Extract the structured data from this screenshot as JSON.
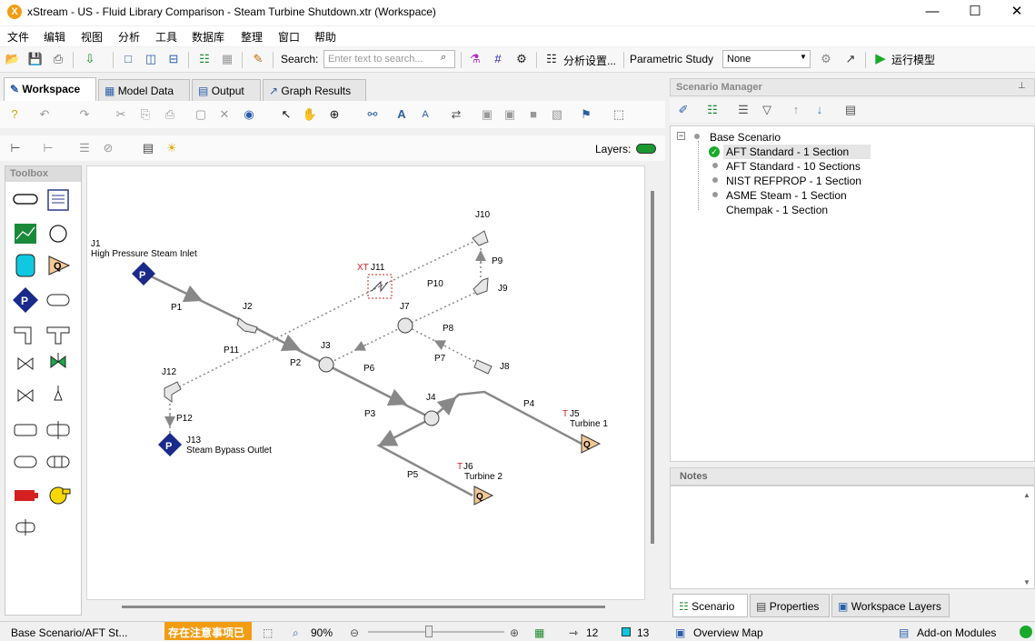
{
  "window": {
    "title": "xStream - US - Fluid Library Comparison - Steam Turbine Shutdown.xtr (Workspace)",
    "logo": "X",
    "minimize": "—",
    "maximize": "☐",
    "close": "✕"
  },
  "menu": [
    "文件",
    "编辑",
    "视图",
    "分析",
    "工具",
    "数据库",
    "整理",
    "窗口",
    "帮助"
  ],
  "toolbar": {
    "search_label": "Search:",
    "search_placeholder": "Enter text to search...",
    "analysis_settings": "分析设置...",
    "parametric_label": "Parametric Study",
    "parametric_value": "None",
    "run_label": "运行模型"
  },
  "tabs": [
    "Workspace",
    "Model Data",
    "Output",
    "Graph Results"
  ],
  "layers_label": "Layers:",
  "toolbox_title": "Toolbox",
  "workspace": {
    "labels": {
      "j1_id": "J1",
      "j1_name": "High Pressure Steam Inlet",
      "j2": "J2",
      "j3": "J3",
      "j4": "J4",
      "j5_prefix": "T",
      "j5_id": "J5",
      "j5_name": "Turbine 1",
      "j6_prefix": "T",
      "j6_id": "J6",
      "j6_name": "Turbine 2",
      "j7": "J7",
      "j8": "J8",
      "j9": "J9",
      "j10": "J10",
      "j11_prefix": "XT",
      "j11_id": "J11",
      "j12": "J12",
      "j13_id": "J13",
      "j13_name": "Steam Bypass Outlet",
      "p1": "P1",
      "p2": "P2",
      "p3": "P3",
      "p4": "P4",
      "p5": "P5",
      "p6": "P6",
      "p7": "P7",
      "p8": "P8",
      "p9": "P9",
      "p10": "P10",
      "p11": "P11",
      "p12": "P12",
      "p_symbol": "P",
      "q_symbol": "Q"
    }
  },
  "scenario_manager": {
    "title": "Scenario Manager",
    "pin": "⊥",
    "base": "Base Scenario",
    "children": [
      "AFT Standard - 1 Section",
      "AFT Standard - 10 Sections",
      "NIST REFPROP - 1 Section",
      "ASME Steam - 1 Section",
      "Chempak - 1 Section"
    ],
    "collapse_glyph": "−"
  },
  "notes_title": "Notes",
  "bottom_tabs": [
    "Scenario",
    "Properties",
    "Workspace Layers"
  ],
  "status": {
    "scenario_path": "Base Scenario/AFT St...",
    "warning": "存在注意事项已",
    "zoom": "90%",
    "pipes": "12",
    "junctions": "13",
    "overview": "Overview Map",
    "addons": "Add-on Modules"
  }
}
